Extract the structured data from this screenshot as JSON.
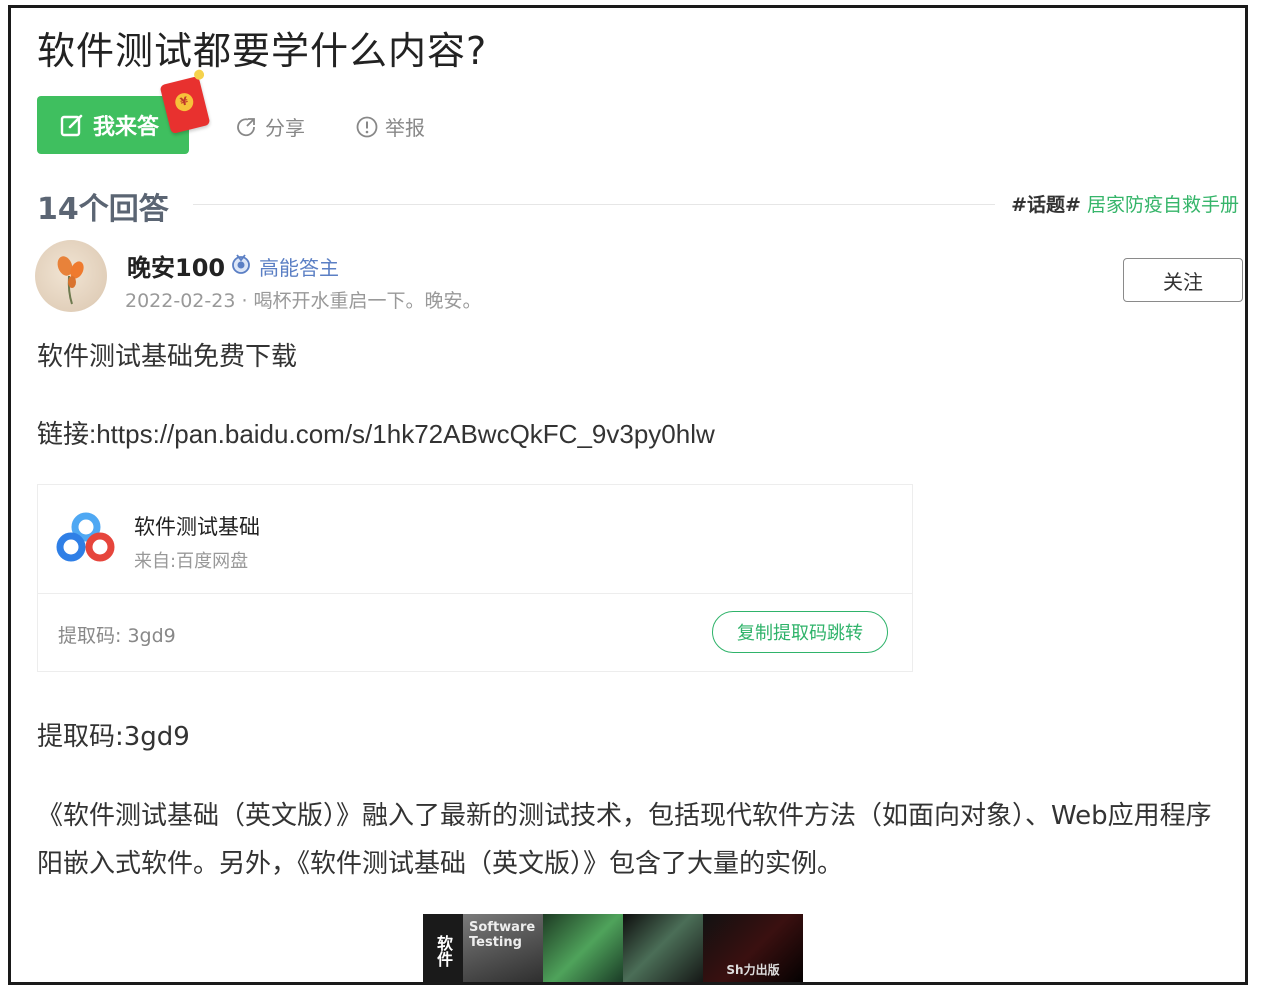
{
  "question": {
    "title": "软件测试都要学什么内容?",
    "answer_button_label": "我来答",
    "share_label": "分享",
    "report_label": "举报"
  },
  "answers_header": {
    "count_label": "14个回答",
    "topic_tag": "#话题#",
    "topic_name": "居家防疫自救手册"
  },
  "answer": {
    "author": "晚安100",
    "badge": "高能答主",
    "meta": "2022-02-23 · 喝杯开水重启一下。晚安。",
    "follow_label": "关注",
    "line1": "软件测试基础免费下载",
    "line2": "链接:https://pan.baidu.com/s/1hk72ABwcQkFC_9v3py0hlw",
    "card": {
      "title": "软件测试基础",
      "source": "来自:百度网盘",
      "code_label": "提取码: 3gd9",
      "copy_button_label": "复制提取码跳转"
    },
    "line3": "提取码:3gd9",
    "paragraph": "《软件测试基础（英文版）》融入了最新的测试技术，包括现代软件方法（如面向对象）、Web应用程序阳嵌入式软件。另外，《软件测试基础（英文版）》包含了大量的实例。"
  },
  "book_cover": {
    "spine": "软件",
    "front": "Software Testing",
    "band": "Sh力出版"
  },
  "colors": {
    "primary_green": "#3fbf5f",
    "link_green": "#36b56a",
    "badge_blue": "#5b7fc4",
    "red_packet": "#e8312f"
  }
}
